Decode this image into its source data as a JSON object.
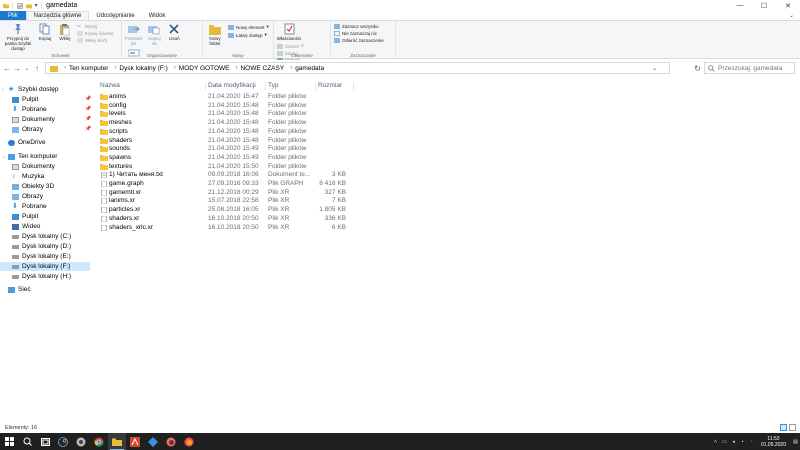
{
  "window": {
    "title": "gamedata",
    "minimize": "—",
    "maximize": "☐",
    "close": "✕"
  },
  "tabs": [
    {
      "label": "Plik"
    },
    {
      "label": "Narzędzia główne"
    },
    {
      "label": "Udostępnianie"
    },
    {
      "label": "Widok"
    }
  ],
  "ribbon": {
    "groups": {
      "clipboard": "Schowek",
      "organize": "Organizowanie",
      "new": "Nowy",
      "open": "Otwieranie",
      "select": "Zaznaczanie"
    },
    "pin_quick": "Przypnij do paska Szybki dostęp",
    "copy": "Kopiuj",
    "paste": "Wklej",
    "cut": "Wytnij",
    "copy_path": "Kopiuj ścieżkę",
    "paste_shortcut": "Wklej skrót",
    "move_to": "Przenieś do",
    "copy_to": "Kopiuj do",
    "delete": "Usuń",
    "rename": "Zmień nazwę",
    "new_folder": "Nowy folder",
    "new_item": "Nowy element",
    "easy_access": "Łatwy dostęp",
    "properties": "Właściwości",
    "open": "Otwórz",
    "edit": "Edytuj",
    "history": "Historia",
    "select_all": "Zaznacz wszystko",
    "select_none": "Nie zaznaczaj nic",
    "invert_selection": "Odwróć zaznaczenie"
  },
  "address": {
    "crumbs": [
      "Ten komputer",
      "Dysk lokalny (F:)",
      "MODY GOTOWE",
      "NOWE CZASY",
      "gamedata"
    ],
    "search_placeholder": "Przeszukaj: gamedata"
  },
  "sidebar": {
    "quick_access": "Szybki dostęp",
    "quick_items": [
      "Pulpit",
      "Pobrane",
      "Dokumenty",
      "Obrazy"
    ],
    "onedrive": "OneDrive",
    "this_pc": "Ten komputer",
    "pc_items": [
      "Dokumenty",
      "Muzyka",
      "Obiekty 3D",
      "Obrazy",
      "Pobrane",
      "Pulpit",
      "Wideo",
      "Dysk lokalny (C:)",
      "Dysk lokalny (D:)",
      "Dysk lokalny (E:)",
      "Dysk lokalny (F:)",
      "Dysk lokalny (H:)"
    ],
    "network": "Sieć"
  },
  "columns": {
    "name": "Nazwa",
    "date": "Data modyfikacji",
    "type": "Typ",
    "size": "Rozmiar"
  },
  "files": [
    {
      "name": "anims",
      "date": "21.04.2020 15:47",
      "type": "Folder plików",
      "size": "",
      "kind": "folder"
    },
    {
      "name": "config",
      "date": "21.04.2020 15:48",
      "type": "Folder plików",
      "size": "",
      "kind": "folder"
    },
    {
      "name": "levels",
      "date": "21.04.2020 15:48",
      "type": "Folder plików",
      "size": "",
      "kind": "folder"
    },
    {
      "name": "meshes",
      "date": "21.04.2020 15:48",
      "type": "Folder plików",
      "size": "",
      "kind": "folder"
    },
    {
      "name": "scripts",
      "date": "21.04.2020 15:48",
      "type": "Folder plików",
      "size": "",
      "kind": "folder"
    },
    {
      "name": "shaders",
      "date": "21.04.2020 15:48",
      "type": "Folder plików",
      "size": "",
      "kind": "folder"
    },
    {
      "name": "sounds",
      "date": "21.04.2020 15:49",
      "type": "Folder plików",
      "size": "",
      "kind": "folder"
    },
    {
      "name": "spawns",
      "date": "21.04.2020 15:49",
      "type": "Folder plików",
      "size": "",
      "kind": "folder"
    },
    {
      "name": "textures",
      "date": "21.04.2020 15:50",
      "type": "Folder plików",
      "size": "",
      "kind": "folder"
    },
    {
      "name": "1) Читать меня.txt",
      "date": "09.09.2018 16:06",
      "type": "Dokument te...",
      "size": "3 KB",
      "kind": "txt"
    },
    {
      "name": "game.graph",
      "date": "27.09.2016 09:33",
      "type": "Plik GRAPH",
      "size": "8 416 KB",
      "kind": "file"
    },
    {
      "name": "gamemtl.xr",
      "date": "21.12.2018 00:29",
      "type": "Plik XR",
      "size": "327 KB",
      "kind": "file"
    },
    {
      "name": "lanims.xr",
      "date": "15.07.2018 22:58",
      "type": "Plik XR",
      "size": "7 KB",
      "kind": "file"
    },
    {
      "name": "particles.xr",
      "date": "25.08.2018 16:05",
      "type": "Plik XR",
      "size": "1 805 KB",
      "kind": "file"
    },
    {
      "name": "shaders.xr",
      "date": "16.10.2018 20:50",
      "type": "Plik XR",
      "size": "336 KB",
      "kind": "file"
    },
    {
      "name": "shaders_xrlc.xr",
      "date": "16.10.2018 20:50",
      "type": "Plik XR",
      "size": "6 KB",
      "kind": "file"
    }
  ],
  "status": {
    "items_count": "Elementy: 16"
  },
  "taskbar": {
    "time": "11:53",
    "date": "01.05.2020"
  },
  "colors": {
    "accent": "#1979ca",
    "selected": "#cce8ff",
    "folder": "#f5c542",
    "taskbar": "#202020"
  }
}
